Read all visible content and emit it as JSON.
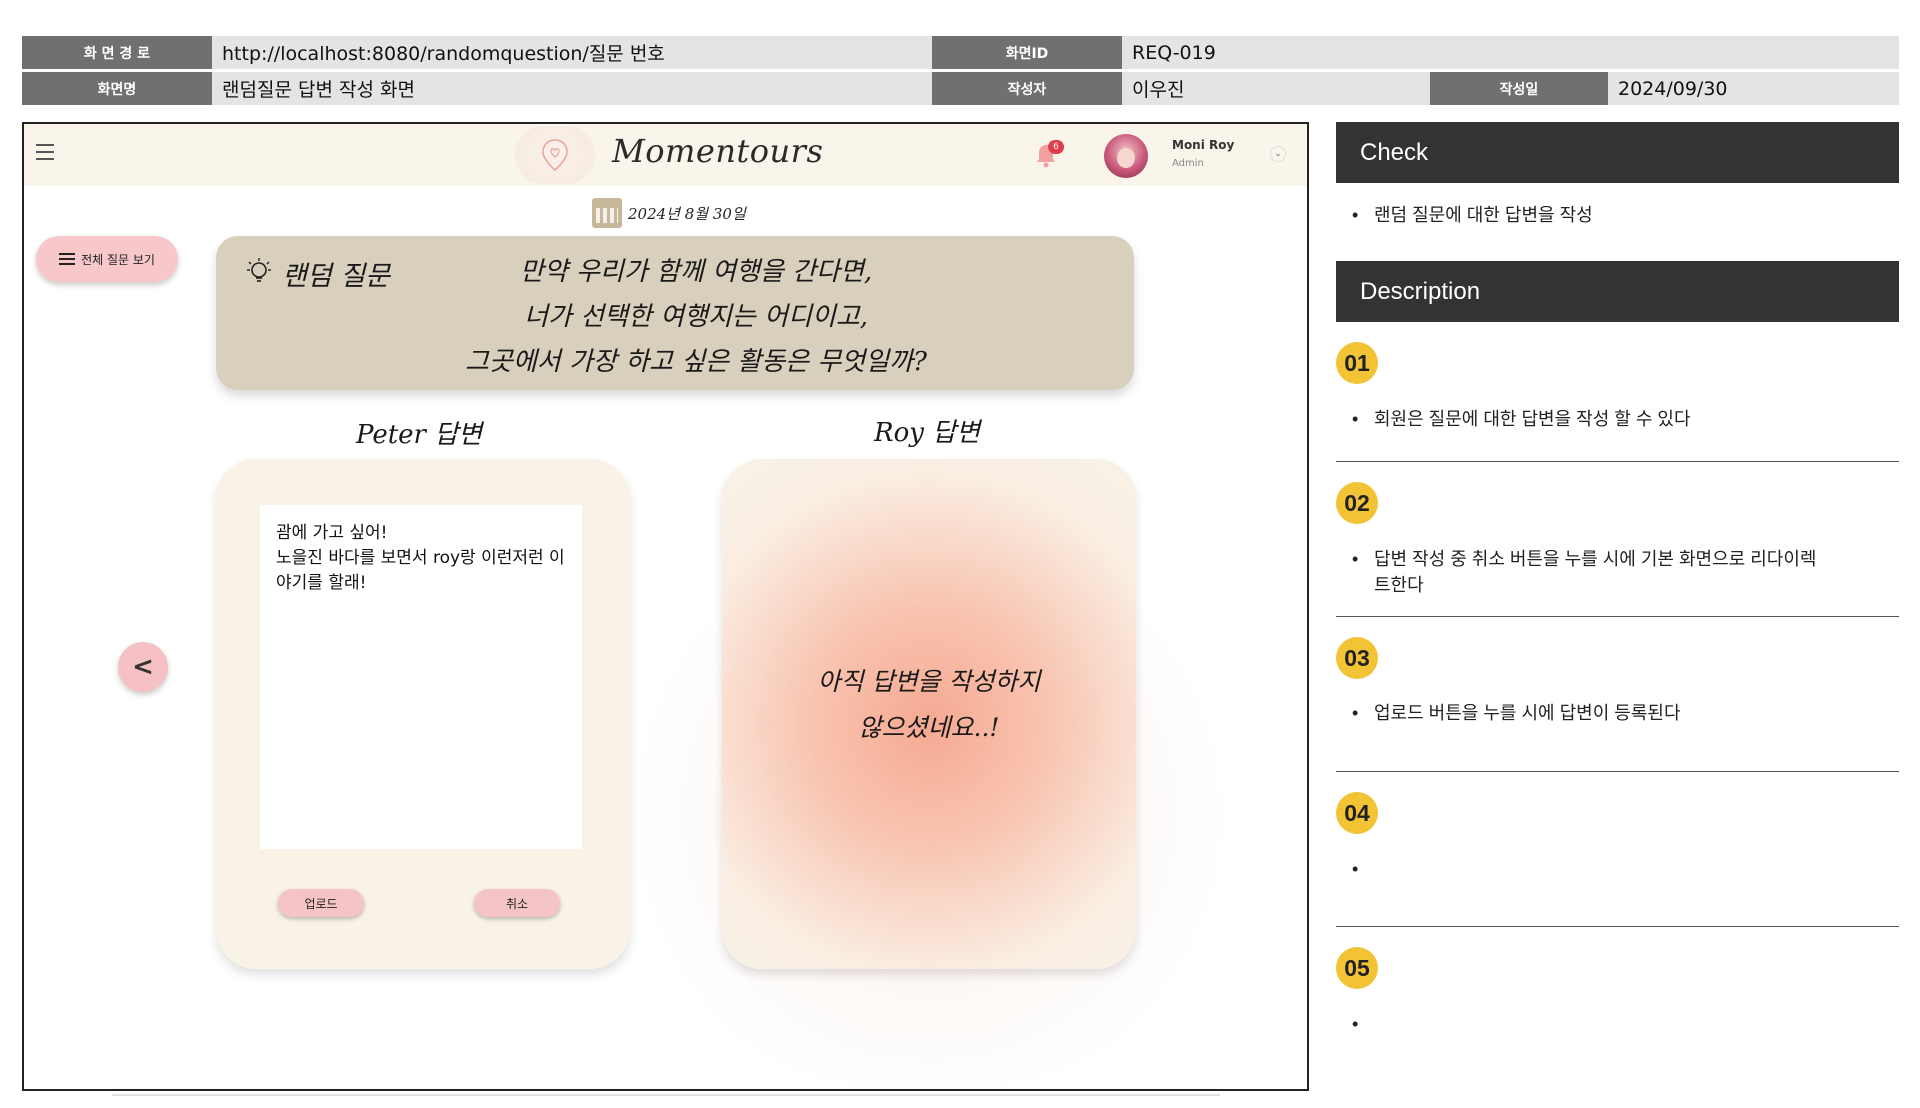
{
  "meta": {
    "path_label": "화 면 경 로",
    "path_value": "http://localhost:8080/randomquestion/질문 번호",
    "screen_id_label": "화면ID",
    "screen_id_value": "REQ-019",
    "screen_name_label": "화면명",
    "screen_name_value": "랜덤질문 답변 작성 화면",
    "author_label": "작성자",
    "author_value": "이우진",
    "date_label": "작성일",
    "date_value": "2024/09/30"
  },
  "app": {
    "logo_text": "Momentours",
    "notification_count": "6",
    "user_name": "Moni Roy",
    "user_role": "Admin",
    "date": "2024년 8월 30일",
    "all_questions_button": "전체 질문 보기",
    "question_label": "랜덤 질문",
    "question_lines": [
      "만약 우리가 함께 여행을 간다면,",
      "너가 선택한 여행지는 어디이고,",
      "그곳에서 가장 하고 싶은 활동은 무엇일까?"
    ],
    "peter_title": "Peter 답변",
    "peter_answer": "괌에 가고 싶어!\n노을진 바다를 보면서 roy랑 이런저런 이야기를 할래!",
    "upload_button": "업로드",
    "cancel_button": "취소",
    "roy_title": "Roy 답변",
    "roy_empty_lines": [
      "아직 답변을 작성하지",
      "않으셨네요..!"
    ],
    "prev_button": "<"
  },
  "panel": {
    "check_title": "Check",
    "check_item": "랜덤 질문에 대한 답변을 작성",
    "description_title": "Description",
    "items": [
      {
        "num": "01",
        "text": "회원은 질문에 대한 답변을 작성 할 수 있다"
      },
      {
        "num": "02",
        "text": "답변 작성 중 취소 버튼을 누를 시에 기본 화면으로 리다이렉\n트한다"
      },
      {
        "num": "03",
        "text": "업로드 버튼을 누를 시에 답변이 등록된다"
      },
      {
        "num": "04",
        "text": ""
      },
      {
        "num": "05",
        "text": ""
      }
    ]
  },
  "colors": {
    "accent_badge": "#f3c336",
    "panel_header": "#333333",
    "pink_button": "#f7c7c9",
    "question_card": "#d8cfbd",
    "answer_card": "#f8f2e7"
  }
}
